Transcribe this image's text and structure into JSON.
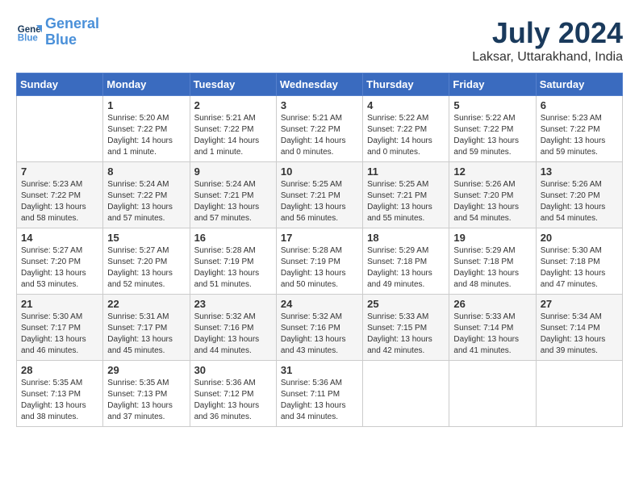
{
  "header": {
    "logo_line1": "General",
    "logo_line2": "Blue",
    "month_year": "July 2024",
    "location": "Laksar, Uttarakhand, India"
  },
  "days_of_week": [
    "Sunday",
    "Monday",
    "Tuesday",
    "Wednesday",
    "Thursday",
    "Friday",
    "Saturday"
  ],
  "weeks": [
    [
      {
        "day": "",
        "info": ""
      },
      {
        "day": "1",
        "info": "Sunrise: 5:20 AM\nSunset: 7:22 PM\nDaylight: 14 hours\nand 1 minute."
      },
      {
        "day": "2",
        "info": "Sunrise: 5:21 AM\nSunset: 7:22 PM\nDaylight: 14 hours\nand 1 minute."
      },
      {
        "day": "3",
        "info": "Sunrise: 5:21 AM\nSunset: 7:22 PM\nDaylight: 14 hours\nand 0 minutes."
      },
      {
        "day": "4",
        "info": "Sunrise: 5:22 AM\nSunset: 7:22 PM\nDaylight: 14 hours\nand 0 minutes."
      },
      {
        "day": "5",
        "info": "Sunrise: 5:22 AM\nSunset: 7:22 PM\nDaylight: 13 hours\nand 59 minutes."
      },
      {
        "day": "6",
        "info": "Sunrise: 5:23 AM\nSunset: 7:22 PM\nDaylight: 13 hours\nand 59 minutes."
      }
    ],
    [
      {
        "day": "7",
        "info": "Sunrise: 5:23 AM\nSunset: 7:22 PM\nDaylight: 13 hours\nand 58 minutes."
      },
      {
        "day": "8",
        "info": "Sunrise: 5:24 AM\nSunset: 7:22 PM\nDaylight: 13 hours\nand 57 minutes."
      },
      {
        "day": "9",
        "info": "Sunrise: 5:24 AM\nSunset: 7:21 PM\nDaylight: 13 hours\nand 57 minutes."
      },
      {
        "day": "10",
        "info": "Sunrise: 5:25 AM\nSunset: 7:21 PM\nDaylight: 13 hours\nand 56 minutes."
      },
      {
        "day": "11",
        "info": "Sunrise: 5:25 AM\nSunset: 7:21 PM\nDaylight: 13 hours\nand 55 minutes."
      },
      {
        "day": "12",
        "info": "Sunrise: 5:26 AM\nSunset: 7:20 PM\nDaylight: 13 hours\nand 54 minutes."
      },
      {
        "day": "13",
        "info": "Sunrise: 5:26 AM\nSunset: 7:20 PM\nDaylight: 13 hours\nand 54 minutes."
      }
    ],
    [
      {
        "day": "14",
        "info": "Sunrise: 5:27 AM\nSunset: 7:20 PM\nDaylight: 13 hours\nand 53 minutes."
      },
      {
        "day": "15",
        "info": "Sunrise: 5:27 AM\nSunset: 7:20 PM\nDaylight: 13 hours\nand 52 minutes."
      },
      {
        "day": "16",
        "info": "Sunrise: 5:28 AM\nSunset: 7:19 PM\nDaylight: 13 hours\nand 51 minutes."
      },
      {
        "day": "17",
        "info": "Sunrise: 5:28 AM\nSunset: 7:19 PM\nDaylight: 13 hours\nand 50 minutes."
      },
      {
        "day": "18",
        "info": "Sunrise: 5:29 AM\nSunset: 7:18 PM\nDaylight: 13 hours\nand 49 minutes."
      },
      {
        "day": "19",
        "info": "Sunrise: 5:29 AM\nSunset: 7:18 PM\nDaylight: 13 hours\nand 48 minutes."
      },
      {
        "day": "20",
        "info": "Sunrise: 5:30 AM\nSunset: 7:18 PM\nDaylight: 13 hours\nand 47 minutes."
      }
    ],
    [
      {
        "day": "21",
        "info": "Sunrise: 5:30 AM\nSunset: 7:17 PM\nDaylight: 13 hours\nand 46 minutes."
      },
      {
        "day": "22",
        "info": "Sunrise: 5:31 AM\nSunset: 7:17 PM\nDaylight: 13 hours\nand 45 minutes."
      },
      {
        "day": "23",
        "info": "Sunrise: 5:32 AM\nSunset: 7:16 PM\nDaylight: 13 hours\nand 44 minutes."
      },
      {
        "day": "24",
        "info": "Sunrise: 5:32 AM\nSunset: 7:16 PM\nDaylight: 13 hours\nand 43 minutes."
      },
      {
        "day": "25",
        "info": "Sunrise: 5:33 AM\nSunset: 7:15 PM\nDaylight: 13 hours\nand 42 minutes."
      },
      {
        "day": "26",
        "info": "Sunrise: 5:33 AM\nSunset: 7:14 PM\nDaylight: 13 hours\nand 41 minutes."
      },
      {
        "day": "27",
        "info": "Sunrise: 5:34 AM\nSunset: 7:14 PM\nDaylight: 13 hours\nand 39 minutes."
      }
    ],
    [
      {
        "day": "28",
        "info": "Sunrise: 5:35 AM\nSunset: 7:13 PM\nDaylight: 13 hours\nand 38 minutes."
      },
      {
        "day": "29",
        "info": "Sunrise: 5:35 AM\nSunset: 7:13 PM\nDaylight: 13 hours\nand 37 minutes."
      },
      {
        "day": "30",
        "info": "Sunrise: 5:36 AM\nSunset: 7:12 PM\nDaylight: 13 hours\nand 36 minutes."
      },
      {
        "day": "31",
        "info": "Sunrise: 5:36 AM\nSunset: 7:11 PM\nDaylight: 13 hours\nand 34 minutes."
      },
      {
        "day": "",
        "info": ""
      },
      {
        "day": "",
        "info": ""
      },
      {
        "day": "",
        "info": ""
      }
    ]
  ]
}
